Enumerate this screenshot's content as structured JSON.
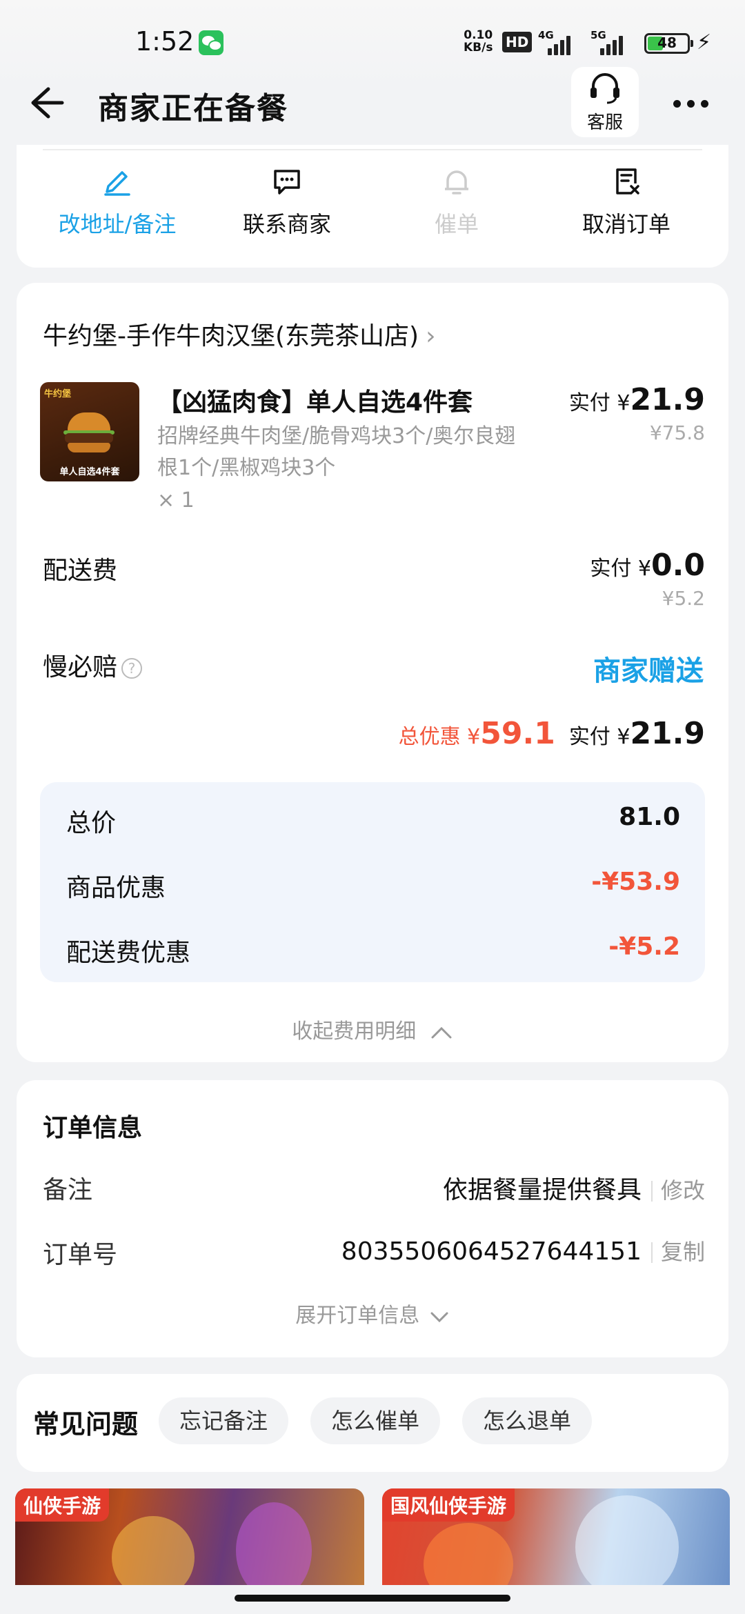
{
  "status_bar": {
    "time": "1:52",
    "net_speed_value": "0.10",
    "net_speed_unit": "KB/s",
    "hd_label": "HD",
    "signal_1": "4G",
    "signal_2": "5G",
    "battery_level": "48"
  },
  "header": {
    "title": "商家正在备餐",
    "service_label": "客服"
  },
  "actions": [
    {
      "label": "改地址/备注",
      "color": "#1aa1e6"
    },
    {
      "label": "联系商家",
      "color": "#111111"
    },
    {
      "label": "催单",
      "color": "#cccccc"
    },
    {
      "label": "取消订单",
      "color": "#111111"
    }
  ],
  "order": {
    "shop_name": "牛约堡-手作牛肉汉堡(东莞茶山店)",
    "product": {
      "thumb_brand": "牛约堡",
      "thumb_caption": "单人自选4件套",
      "name": "【凶猛肉食】单人自选4件套",
      "desc": "招牌经典牛肉堡/脆骨鸡块3个/奥尔良翅根1个/黑椒鸡块3个",
      "qty": "× 1",
      "paid_label": "实付 ¥",
      "paid_value": "21.9",
      "original_price": "¥75.8"
    },
    "delivery": {
      "label": "配送费",
      "paid_label": "实付 ¥",
      "paid_value": "0.0",
      "original_price": "¥5.2"
    },
    "slow_compensation": {
      "label": "慢必赔",
      "help": "?",
      "value": "商家赠送"
    },
    "summary": {
      "discount_label": "总优惠 ¥",
      "discount_value": "59.1",
      "paid_label": "实付 ¥",
      "paid_value": "21.9"
    },
    "fees": [
      {
        "label": "总价",
        "value": "81.0"
      },
      {
        "label": "商品优惠",
        "value": "-¥53.9"
      },
      {
        "label": "配送费优惠",
        "value": "-¥5.2"
      }
    ],
    "collapse_label": "收起费用明细"
  },
  "order_info": {
    "title": "订单信息",
    "remark_label": "备注",
    "remark_value": "依据餐量提供餐具",
    "remark_action": "修改",
    "order_no_label": "订单号",
    "order_no_value": "8035506064527644151",
    "order_no_action": "复制",
    "expand_label": "展开订单信息"
  },
  "faq": {
    "title": "常见问题",
    "chips": [
      "忘记备注",
      "怎么催单",
      "怎么退单"
    ]
  },
  "ads": [
    {
      "tag": "仙侠手游"
    },
    {
      "tag": "国风仙侠手游"
    }
  ]
}
